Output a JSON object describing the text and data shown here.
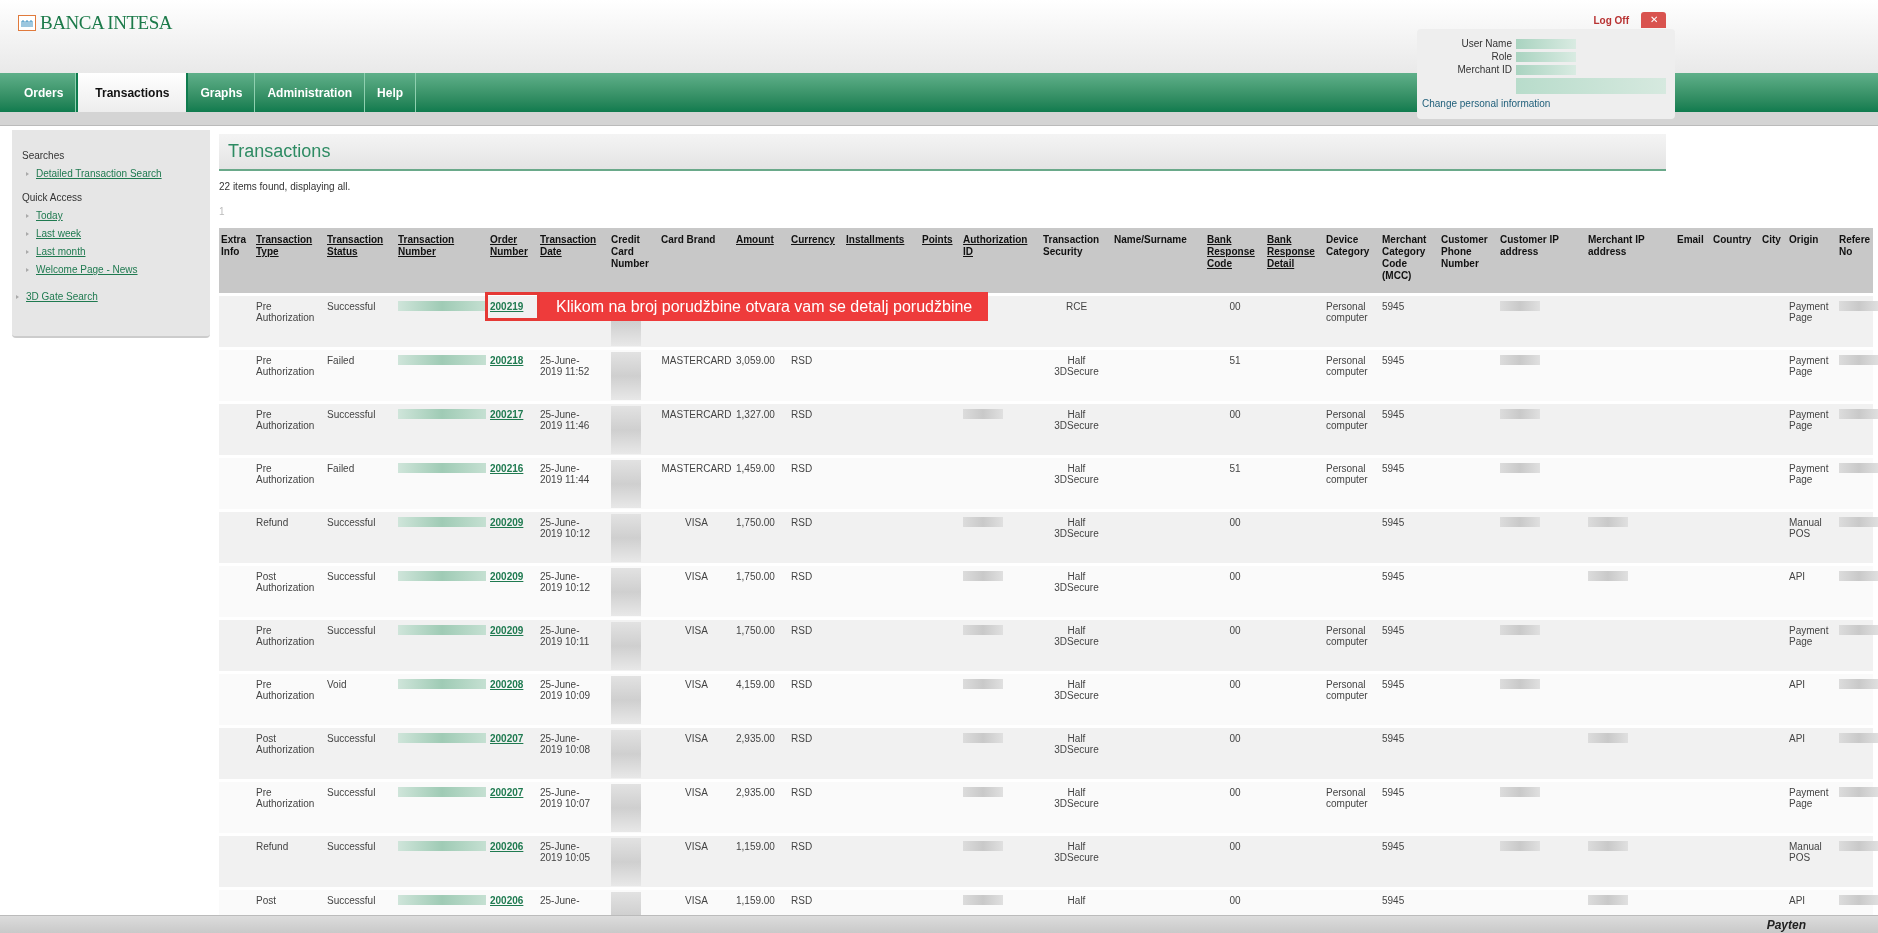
{
  "brand": {
    "name": "BANCA INTESA"
  },
  "tabs": [
    {
      "label": "Orders",
      "selected": false
    },
    {
      "label": "Transactions",
      "selected": true
    },
    {
      "label": "Graphs",
      "selected": false
    },
    {
      "label": "Administration",
      "selected": false
    },
    {
      "label": "Help",
      "selected": false
    }
  ],
  "logoff": {
    "label": "Log Off",
    "close": "✕"
  },
  "user_panel": {
    "fields": [
      "User Name",
      "Role",
      "Merchant ID"
    ],
    "link": "Change personal information"
  },
  "sidebar": {
    "groups": [
      {
        "title": "Searches",
        "items": [
          "Detailed Transaction Search"
        ]
      },
      {
        "title": "Quick Access",
        "items": [
          "Today",
          "Last week",
          "Last month",
          "Welcome Page - News"
        ]
      }
    ],
    "extra_link": "3D Gate Search"
  },
  "page_title": "Transactions",
  "summary": "22 items found, displaying all.",
  "pager": "1",
  "annotation": {
    "text": "Klikom na broj porudžbine otvara vam se detalj porudžbine"
  },
  "table": {
    "columns": [
      {
        "label": "Extra Info",
        "sortable": false
      },
      {
        "label": "Transaction Type",
        "sortable": true
      },
      {
        "label": "Transaction Status",
        "sortable": true
      },
      {
        "label": "Transaction Number",
        "sortable": true
      },
      {
        "label": "Order Number",
        "sortable": true
      },
      {
        "label": "Transaction Date",
        "sortable": true
      },
      {
        "label": "Credit Card Number",
        "sortable": false
      },
      {
        "label": "Card Brand",
        "sortable": false
      },
      {
        "label": "Amount",
        "sortable": true
      },
      {
        "label": "Currency",
        "sortable": true
      },
      {
        "label": "Installments",
        "sortable": true
      },
      {
        "label": "Points",
        "sortable": true
      },
      {
        "label": "Authorization ID",
        "sortable": true
      },
      {
        "label": "Transaction Security",
        "sortable": false
      },
      {
        "label": "Name/Surname",
        "sortable": false
      },
      {
        "label": "Bank Response Code",
        "sortable": true
      },
      {
        "label": "Bank Response Detail",
        "sortable": true
      },
      {
        "label": "Device Category",
        "sortable": false
      },
      {
        "label": "Merchant Category Code (MCC)",
        "sortable": false
      },
      {
        "label": "Customer Phone Number",
        "sortable": false
      },
      {
        "label": "Customer IP address",
        "sortable": false
      },
      {
        "label": "Merchant IP address",
        "sortable": false
      },
      {
        "label": "Email",
        "sortable": false
      },
      {
        "label": "Country",
        "sortable": false
      },
      {
        "label": "City",
        "sortable": false
      },
      {
        "label": "Origin",
        "sortable": false
      },
      {
        "label": "Refere No",
        "sortable": false
      }
    ],
    "rows": [
      {
        "type": "Pre Authorization",
        "status": "Successful",
        "number": {
          "redacted": true
        },
        "order": "200219",
        "card": {
          "redacted": true
        },
        "security": "RCE",
        "code": "00",
        "device": "Personal computer",
        "mcc": "5945",
        "customer_ip": {
          "redacted": true
        },
        "origin": "Payment Page",
        "reference": {
          "redacted": true
        }
      },
      {
        "type": "Pre Authorization",
        "status": "Failed",
        "number": {
          "redacted": true
        },
        "order": "200218",
        "date": "25-June-2019 11:52",
        "card": {
          "redacted": true
        },
        "brand": "MASTERCARD",
        "amount": "3,059.00",
        "currency": "RSD",
        "security": "Half 3DSecure",
        "code": "51",
        "device": "Personal computer",
        "mcc": "5945",
        "customer_ip": {
          "redacted": true
        },
        "origin": "Payment Page",
        "reference": {
          "redacted": true
        }
      },
      {
        "type": "Pre Authorization",
        "status": "Successful",
        "number": {
          "redacted": true
        },
        "order": "200217",
        "date": "25-June-2019 11:46",
        "card": {
          "redacted": true
        },
        "brand": "MASTERCARD",
        "amount": "1,327.00",
        "currency": "RSD",
        "auth": {
          "redacted": true
        },
        "security": "Half 3DSecure",
        "code": "00",
        "device": "Personal computer",
        "mcc": "5945",
        "customer_ip": {
          "redacted": true
        },
        "origin": "Payment Page",
        "reference": {
          "redacted": true
        }
      },
      {
        "type": "Pre Authorization",
        "status": "Failed",
        "number": {
          "redacted": true
        },
        "order": "200216",
        "date": "25-June-2019 11:44",
        "card": {
          "redacted": true
        },
        "brand": "MASTERCARD",
        "amount": "1,459.00",
        "currency": "RSD",
        "security": "Half 3DSecure",
        "code": "51",
        "device": "Personal computer",
        "mcc": "5945",
        "customer_ip": {
          "redacted": true
        },
        "origin": "Payment Page",
        "reference": {
          "redacted": true
        }
      },
      {
        "type": "Refund",
        "status": "Successful",
        "number": {
          "redacted": true
        },
        "order": "200209",
        "date": "25-June-2019 10:12",
        "card": {
          "redacted": true
        },
        "brand": "VISA",
        "amount": "1,750.00",
        "currency": "RSD",
        "auth": {
          "redacted": true
        },
        "security": "Half 3DSecure",
        "code": "00",
        "mcc": "5945",
        "customer_ip": {
          "redacted": true
        },
        "merchant_ip": {
          "redacted": true
        },
        "origin": "Manual POS",
        "reference": {
          "redacted": true
        }
      },
      {
        "type": "Post Authorization",
        "status": "Successful",
        "number": {
          "redacted": true
        },
        "order": "200209",
        "date": "25-June-2019 10:12",
        "card": {
          "redacted": true
        },
        "brand": "VISA",
        "amount": "1,750.00",
        "currency": "RSD",
        "auth": {
          "redacted": true
        },
        "security": "Half 3DSecure",
        "code": "00",
        "mcc": "5945",
        "merchant_ip": {
          "redacted": true
        },
        "origin": "API",
        "reference": {
          "redacted": true
        }
      },
      {
        "type": "Pre Authorization",
        "status": "Successful",
        "number": {
          "redacted": true
        },
        "order": "200209",
        "date": "25-June-2019 10:11",
        "card": {
          "redacted": true
        },
        "brand": "VISA",
        "amount": "1,750.00",
        "currency": "RSD",
        "auth": {
          "redacted": true
        },
        "security": "Half 3DSecure",
        "code": "00",
        "device": "Personal computer",
        "mcc": "5945",
        "customer_ip": {
          "redacted": true
        },
        "origin": "Payment Page",
        "reference": {
          "redacted": true
        }
      },
      {
        "type": "Pre Authorization",
        "status": "Void",
        "number": {
          "redacted": true
        },
        "order": "200208",
        "date": "25-June-2019 10:09",
        "card": {
          "redacted": true
        },
        "brand": "VISA",
        "amount": "4,159.00",
        "currency": "RSD",
        "auth": {
          "redacted": true
        },
        "security": "Half 3DSecure",
        "code": "00",
        "device": "Personal computer",
        "mcc": "5945",
        "customer_ip": {
          "redacted": true
        },
        "origin": "API",
        "reference": {
          "redacted": true
        }
      },
      {
        "type": "Post Authorization",
        "status": "Successful",
        "number": {
          "redacted": true
        },
        "order": "200207",
        "date": "25-June-2019 10:08",
        "card": {
          "redacted": true
        },
        "brand": "VISA",
        "amount": "2,935.00",
        "currency": "RSD",
        "auth": {
          "redacted": true
        },
        "security": "Half 3DSecure",
        "code": "00",
        "mcc": "5945",
        "merchant_ip": {
          "redacted": true
        },
        "origin": "API",
        "reference": {
          "redacted": true
        }
      },
      {
        "type": "Pre Authorization",
        "status": "Successful",
        "number": {
          "redacted": true
        },
        "order": "200207",
        "date": "25-June-2019 10:07",
        "card": {
          "redacted": true
        },
        "brand": "VISA",
        "amount": "2,935.00",
        "currency": "RSD",
        "auth": {
          "redacted": true
        },
        "security": "Half 3DSecure",
        "code": "00",
        "device": "Personal computer",
        "mcc": "5945",
        "customer_ip": {
          "redacted": true
        },
        "origin": "Payment Page",
        "reference": {
          "redacted": true
        }
      },
      {
        "type": "Refund",
        "status": "Successful",
        "number": {
          "redacted": true
        },
        "order": "200206",
        "date": "25-June-2019 10:05",
        "card": {
          "redacted": true
        },
        "brand": "VISA",
        "amount": "1,159.00",
        "currency": "RSD",
        "auth": {
          "redacted": true
        },
        "security": "Half 3DSecure",
        "code": "00",
        "mcc": "5945",
        "customer_ip": {
          "redacted": true
        },
        "merchant_ip": {
          "redacted": true
        },
        "origin": "Manual POS",
        "reference": {
          "redacted": true
        }
      },
      {
        "type": "Post",
        "status": "Successful",
        "number": {
          "redacted": true
        },
        "order": "200206",
        "date": "25-June-",
        "card": {
          "redacted": true
        },
        "brand": "VISA",
        "amount": "1,159.00",
        "currency": "RSD",
        "auth": {
          "redacted": true
        },
        "security": "Half",
        "code": "00",
        "mcc": "5945",
        "merchant_ip": {
          "redacted": true
        },
        "origin": "API",
        "reference": {
          "redacted": true
        }
      }
    ]
  },
  "footer": {
    "logo": "Payten"
  }
}
